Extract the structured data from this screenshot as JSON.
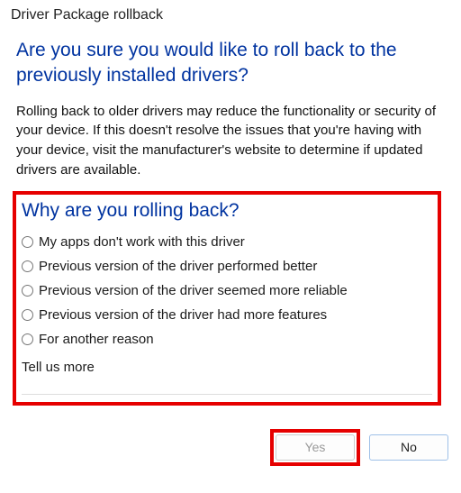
{
  "dialog": {
    "title": "Driver Package rollback"
  },
  "heading": "Are you sure you would like to roll back to the previously installed drivers?",
  "body_text": "Rolling back to older drivers may reduce the functionality or security of your device. If this doesn't resolve the issues that you're having with your device, visit the manufacturer's website to determine if updated drivers are available.",
  "subheading": "Why are you rolling back?",
  "reasons": [
    {
      "label": "My apps don't work with this driver"
    },
    {
      "label": "Previous version of the driver performed better"
    },
    {
      "label": "Previous version of the driver seemed more reliable"
    },
    {
      "label": "Previous version of the driver had more features"
    },
    {
      "label": "For another reason"
    }
  ],
  "tell_more_label": "Tell us more",
  "tell_more_value": "",
  "buttons": {
    "yes": "Yes",
    "no": "No"
  },
  "highlight": {
    "reasons_block": true,
    "yes_button": true
  }
}
